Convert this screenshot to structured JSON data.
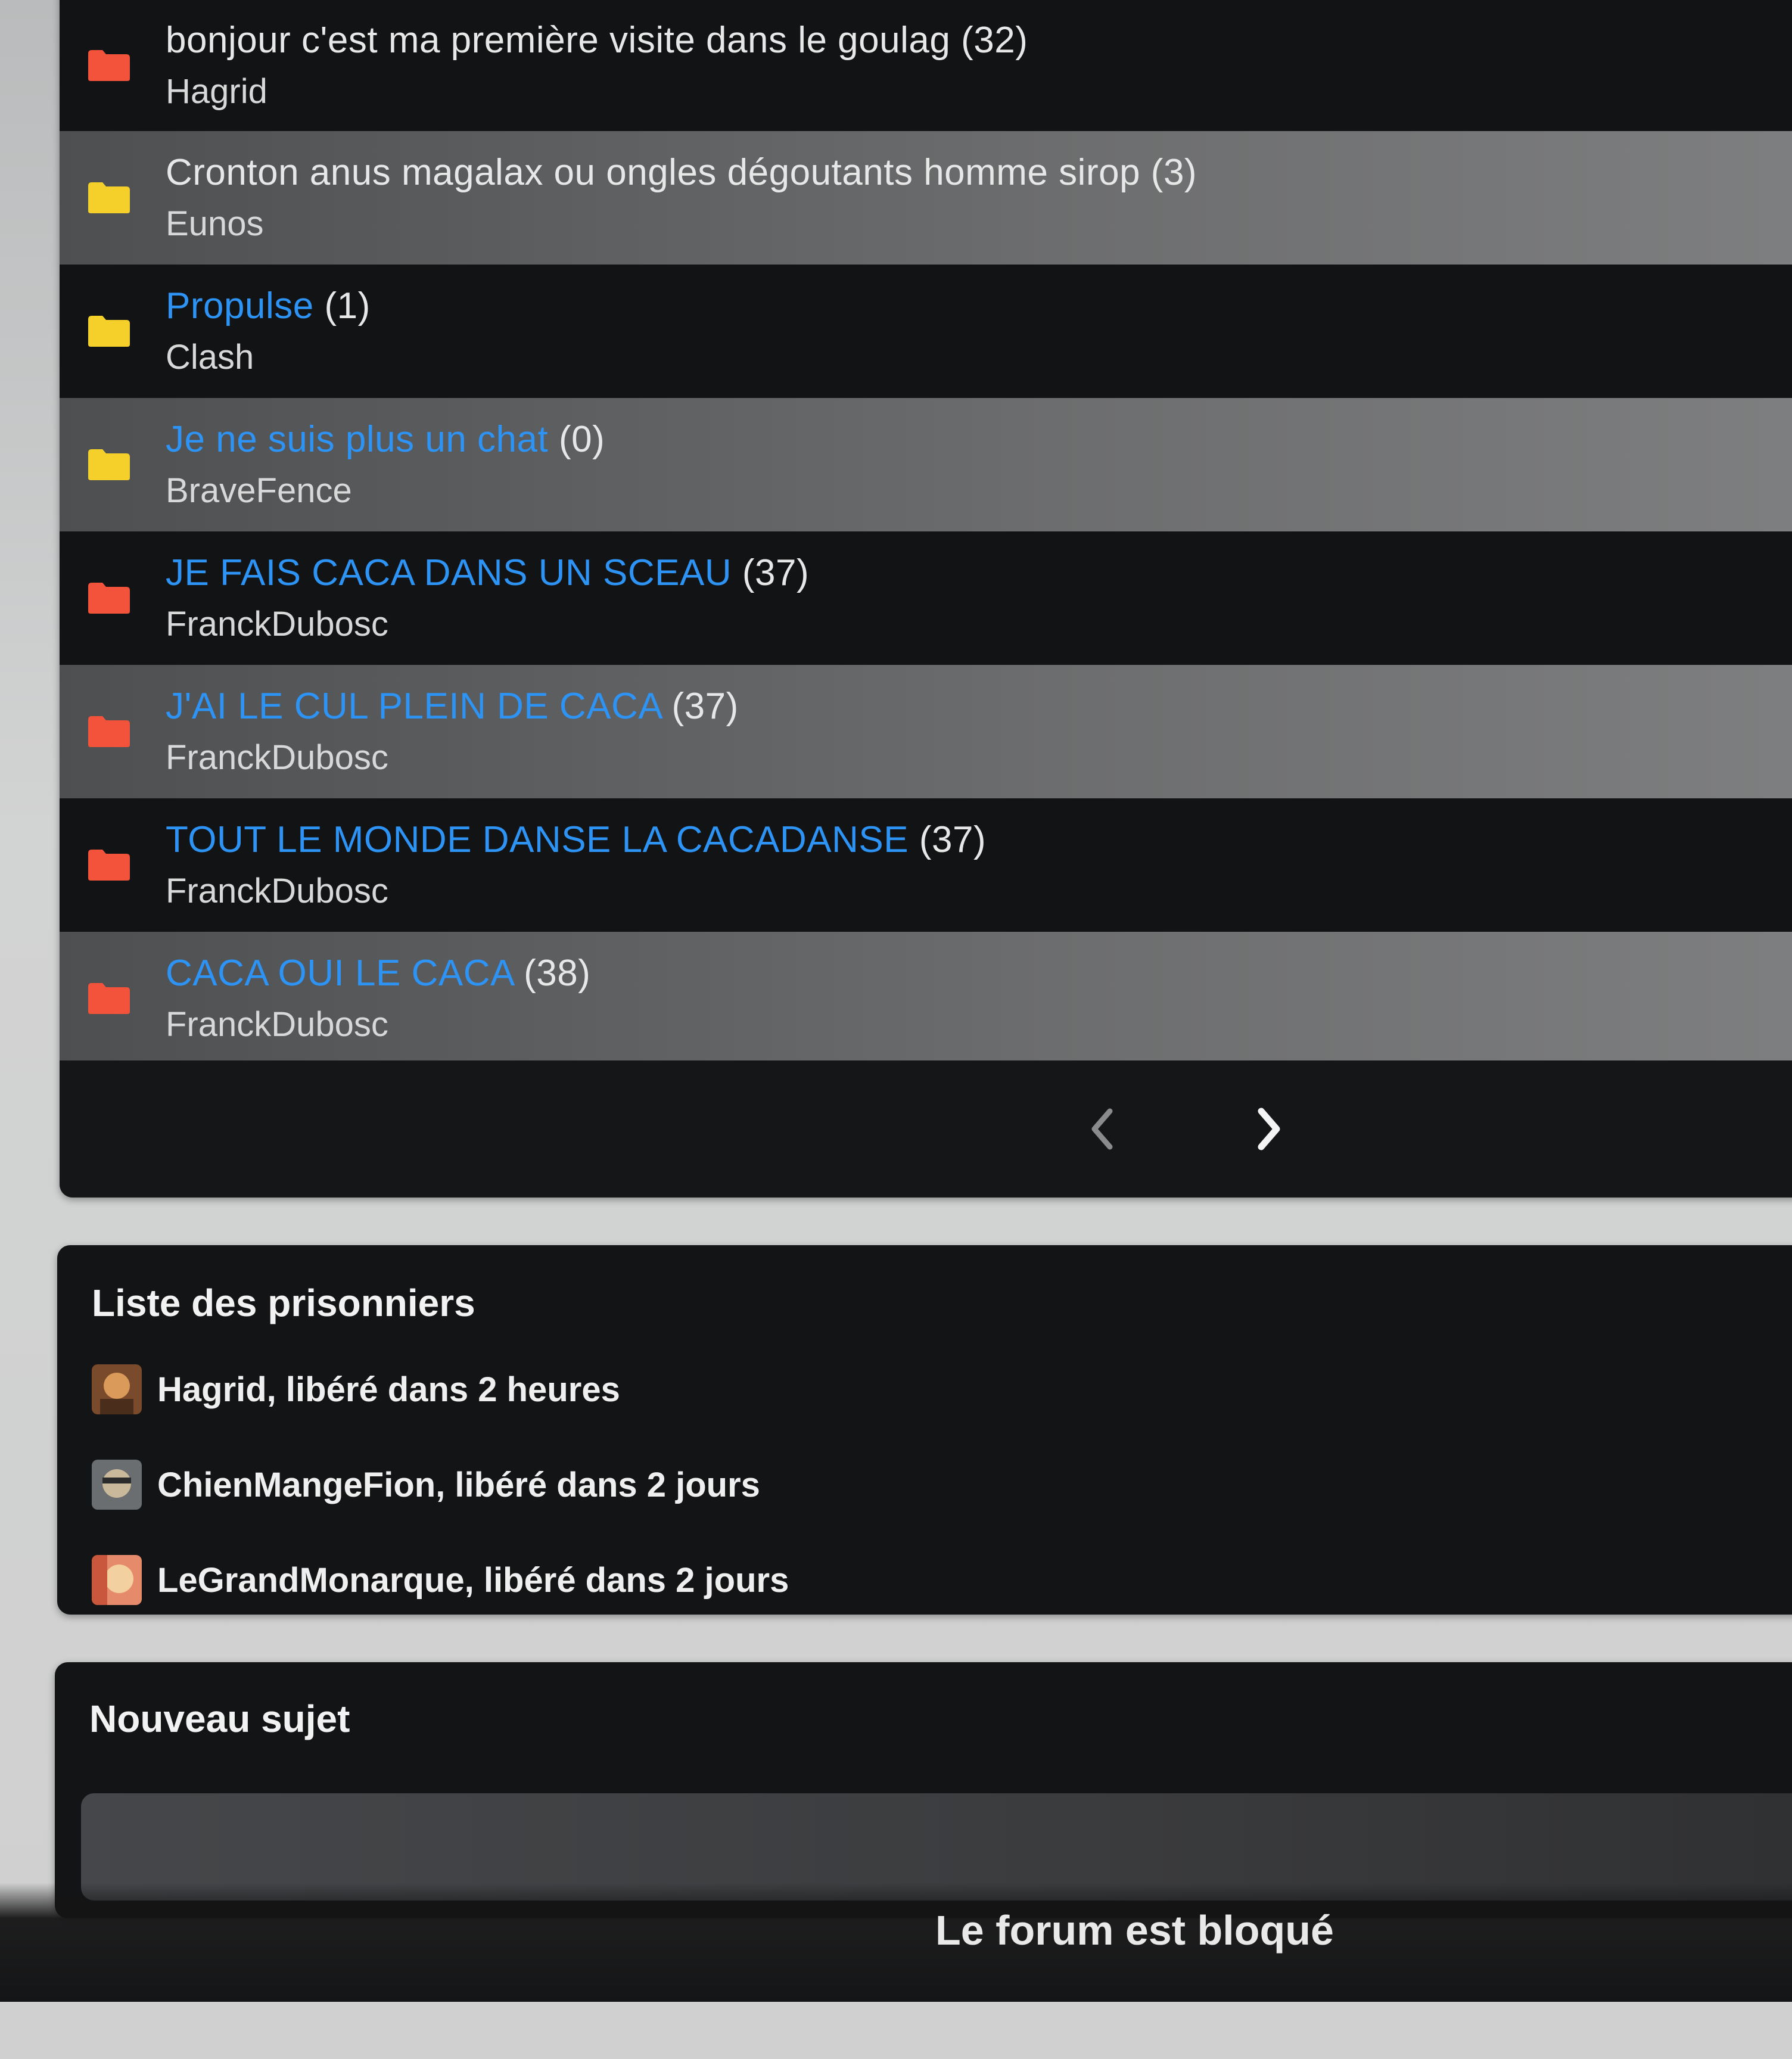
{
  "topics": [
    {
      "title": "bonjour c'est ma première visite dans le goulag",
      "count": "(32)",
      "author": "Hagrid",
      "link": false,
      "folder_color": "#f2533a"
    },
    {
      "title": "Cronton anus magalax ou ongles dégoutants homme sirop",
      "count": "(3)",
      "author": "Eunos",
      "link": false,
      "folder_color": "#f5cf2a"
    },
    {
      "title": "Propulse",
      "count": "(1)",
      "author": "Clash",
      "link": true,
      "folder_color": "#f5cf2a"
    },
    {
      "title": "Je ne suis plus un chat",
      "count": "(0)",
      "author": "BraveFence",
      "link": true,
      "folder_color": "#f5cf2a"
    },
    {
      "title": "JE FAIS CACA DANS UN SCEAU",
      "count": "(37)",
      "author": "FranckDubosc",
      "link": true,
      "folder_color": "#f2533a"
    },
    {
      "title": "J'AI LE CUL PLEIN DE CACA",
      "count": "(37)",
      "author": "FranckDubosc",
      "link": true,
      "folder_color": "#f2533a"
    },
    {
      "title": "TOUT LE MONDE DANSE LA CACADANSE",
      "count": "(37)",
      "author": "FranckDubosc",
      "link": true,
      "folder_color": "#f2533a"
    },
    {
      "title": "CACA OUI LE CACA",
      "count": "(38)",
      "author": "FranckDubosc",
      "link": true,
      "folder_color": "#f2533a"
    }
  ],
  "pagination": {
    "prev_icon": "chevron-left-icon",
    "next_icon": "chevron-right-icon"
  },
  "prisoners": {
    "title": "Liste des prisonniers",
    "items": [
      {
        "text": "Hagrid, libéré dans 2 heures"
      },
      {
        "text": "ChienMangeFion, libéré dans 2 jours"
      },
      {
        "text": "LeGrandMonarque, libéré dans 2 jours"
      }
    ]
  },
  "new_topic": {
    "title": "Nouveau sujet",
    "blocked_message": "Le forum est bloqué"
  },
  "colors": {
    "link": "#2d93f5",
    "folder_hot": "#f2533a",
    "folder_normal": "#f5cf2a",
    "panel_bg": "#131415"
  }
}
